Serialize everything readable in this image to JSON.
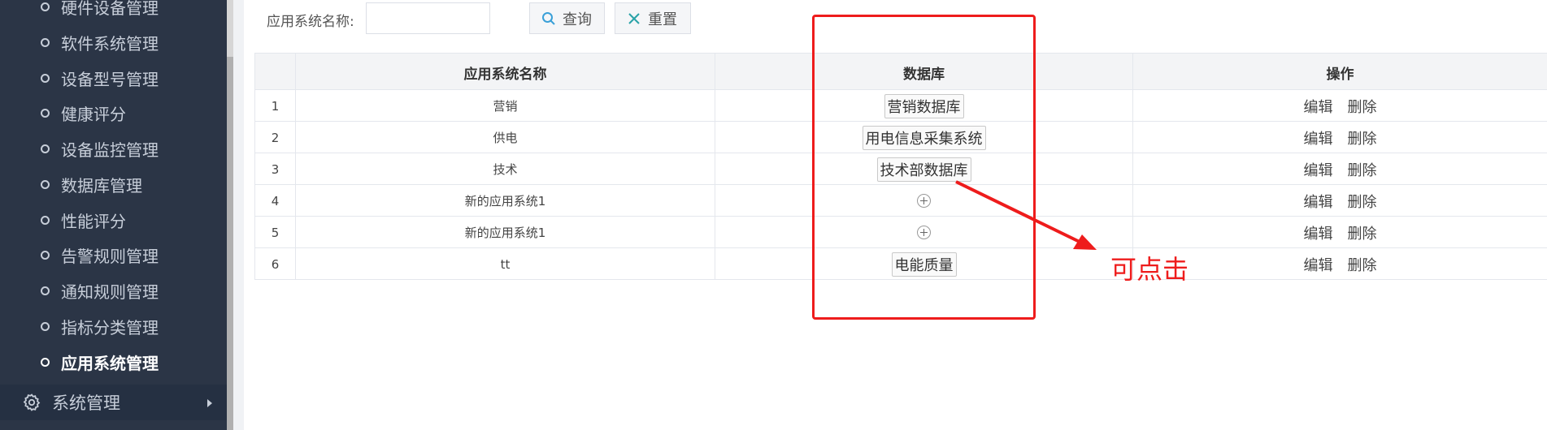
{
  "sidebar": {
    "items": [
      {
        "label": "硬件设备管理",
        "active": false
      },
      {
        "label": "软件系统管理",
        "active": false
      },
      {
        "label": "设备型号管理",
        "active": false
      },
      {
        "label": "健康评分",
        "active": false
      },
      {
        "label": "设备监控管理",
        "active": false
      },
      {
        "label": "数据库管理",
        "active": false
      },
      {
        "label": "性能评分",
        "active": false
      },
      {
        "label": "告警规则管理",
        "active": false
      },
      {
        "label": "通知规则管理",
        "active": false
      },
      {
        "label": "指标分类管理",
        "active": false
      },
      {
        "label": "应用系统管理",
        "active": true
      }
    ],
    "parent": {
      "label": "系统管理",
      "icon": "gear-icon"
    }
  },
  "search": {
    "label": "应用系统名称:",
    "value": "",
    "search_button": "查询",
    "reset_button": "重置"
  },
  "table": {
    "headers": [
      "",
      "应用系统名称",
      "数据库",
      "操作"
    ],
    "rows": [
      {
        "index": "1",
        "name": "营销",
        "database": "营销数据库",
        "has_db": true
      },
      {
        "index": "2",
        "name": "供电",
        "database": "用电信息采集系统",
        "has_db": true
      },
      {
        "index": "3",
        "name": "技术",
        "database": "技术部数据库",
        "has_db": true
      },
      {
        "index": "4",
        "name": "新的应用系统1",
        "database": "",
        "has_db": false
      },
      {
        "index": "5",
        "name": "新的应用系统1",
        "database": "",
        "has_db": false
      },
      {
        "index": "6",
        "name": "tt",
        "database": "电能质量",
        "has_db": true
      }
    ],
    "actions": {
      "edit": "编辑",
      "delete": "删除"
    }
  },
  "annotation": {
    "text": "可点击",
    "color": "#ee1c1c"
  }
}
